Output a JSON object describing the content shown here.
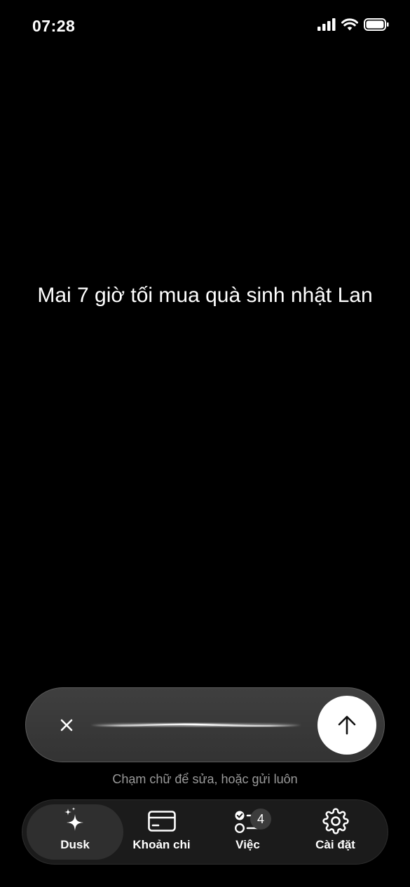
{
  "status_bar": {
    "time": "07:28"
  },
  "transcript": {
    "text": "Mai 7 giờ tối mua quà sinh nhật Lan"
  },
  "input": {
    "hint": "Chạm chữ để sửa, hoặc gửi luôn"
  },
  "tabs": [
    {
      "label": "Dusk",
      "icon": "sparkles-icon",
      "active": true
    },
    {
      "label": "Khoản chi",
      "icon": "card-icon",
      "active": false
    },
    {
      "label": "Việc",
      "icon": "checklist-icon",
      "active": false,
      "badge": "4"
    },
    {
      "label": "Cài đặt",
      "icon": "gear-icon",
      "active": false
    }
  ]
}
